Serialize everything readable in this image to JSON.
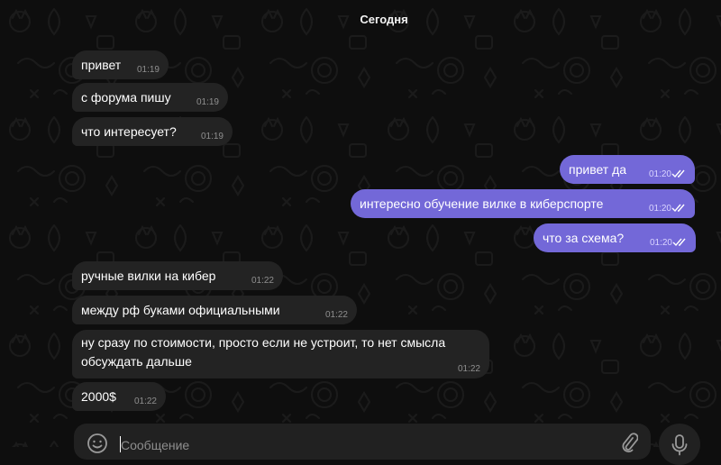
{
  "chat": {
    "date_label": "Сегодня",
    "messages": [
      {
        "direction": "in",
        "text": "привет",
        "time": "01:19"
      },
      {
        "direction": "in",
        "text": "с форума пишу",
        "time": "01:19"
      },
      {
        "direction": "in",
        "text": "что интересует?",
        "time": "01:19"
      },
      {
        "direction": "out",
        "text": "привет да",
        "time": "01:20",
        "status": "read"
      },
      {
        "direction": "out",
        "text": "интересно обучение вилке в киберспорте",
        "time": "01:20",
        "status": "read"
      },
      {
        "direction": "out",
        "text": "что за схема?",
        "time": "01:20",
        "status": "read"
      },
      {
        "direction": "in",
        "text": "ручные вилки на кибер",
        "time": "01:22"
      },
      {
        "direction": "in",
        "text": "между рф буками официальными",
        "time": "01:22"
      },
      {
        "direction": "in",
        "text": "ну сразу по стоимости, просто если не устроит, то нет смысла обсуждать дальше",
        "time": "01:22"
      },
      {
        "direction": "in",
        "text": "2000$",
        "time": "01:22"
      }
    ]
  },
  "composer": {
    "placeholder": "Сообщение",
    "value": ""
  },
  "icons": {
    "emoji": "smile-icon",
    "attach": "paperclip-icon",
    "mic": "microphone-icon",
    "read_status": "double-check-icon"
  },
  "colors": {
    "background": "#0e0e0e",
    "incoming_bubble": "#232323",
    "outgoing_bubble": "#7368d8",
    "composer": "#212121"
  }
}
